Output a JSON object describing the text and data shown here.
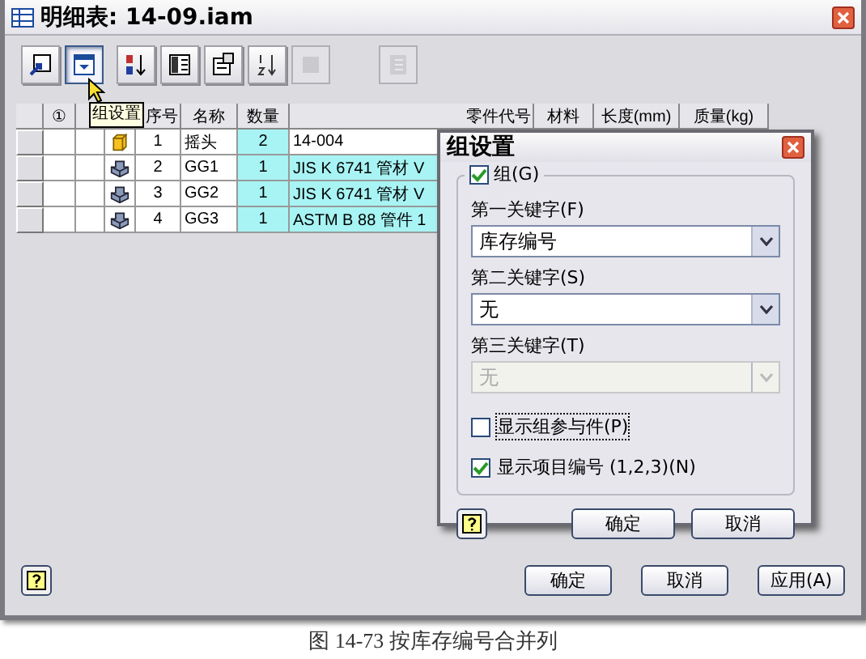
{
  "window": {
    "title": "明细表: 14-09.iam"
  },
  "toolbar": [
    [
      {
        "kind": "export",
        "pressed": false,
        "disabled": false
      },
      {
        "kind": "group",
        "pressed": true,
        "disabled": false
      }
    ],
    [
      {
        "kind": "sort",
        "pressed": false,
        "disabled": false
      },
      {
        "kind": "columns",
        "pressed": false,
        "disabled": false
      },
      {
        "kind": "properties",
        "pressed": false,
        "disabled": false
      },
      {
        "kind": "renumber",
        "pressed": false,
        "disabled": false
      },
      {
        "kind": "blank",
        "pressed": false,
        "disabled": true
      }
    ],
    [
      {
        "kind": "view",
        "pressed": false,
        "disabled": true
      }
    ]
  ],
  "tooltip": "组设置",
  "table": {
    "columns": [
      "①",
      "序号",
      "名称",
      "数量",
      "零件代号",
      "材料",
      "长度(mm)",
      "质量(kg)"
    ],
    "rows": [
      {
        "kind": "part",
        "number": "1",
        "name": "摇头",
        "quantity": "2",
        "part_number": "14-004",
        "highlighted": false
      },
      {
        "kind": "assembly",
        "number": "2",
        "name": "GG1",
        "quantity": "1",
        "part_number": "JIS K 6741 管材 V",
        "highlighted": true
      },
      {
        "kind": "assembly",
        "number": "3",
        "name": "GG2",
        "quantity": "1",
        "part_number": "JIS K 6741 管材 V",
        "highlighted": true
      },
      {
        "kind": "assembly",
        "number": "4",
        "name": "GG3",
        "quantity": "1",
        "part_number": "ASTM B 88 管件 1",
        "highlighted": true
      }
    ]
  },
  "dialog": {
    "title": "组设置",
    "group": {
      "label": "组(G)",
      "checked": true
    },
    "keys": [
      {
        "label": "第一关键字(F)",
        "value": "库存编号",
        "disabled": false
      },
      {
        "label": "第二关键字(S)",
        "value": "无",
        "disabled": false
      },
      {
        "label": "第三关键字(T)",
        "value": "无",
        "disabled": true
      }
    ],
    "options": [
      {
        "label": "显示组参与件(P)",
        "checked": false
      },
      {
        "label": "显示项目编号 (1,2,3)(N)",
        "checked": true
      }
    ],
    "buttons": [
      "确定",
      "取消"
    ]
  },
  "buttons": [
    "确定",
    "取消",
    "应用(A)"
  ],
  "caption": "图 14-73 按库存编号合并列"
}
